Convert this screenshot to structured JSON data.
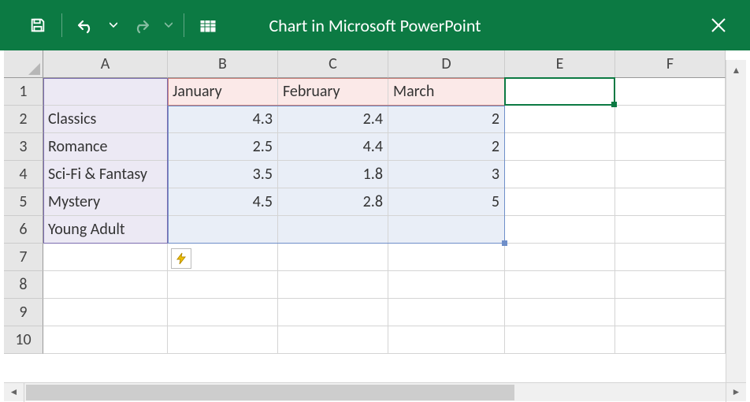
{
  "title": "Chart in Microsoft PowerPoint",
  "columns": {
    "A": 158,
    "B": 140,
    "C": 140,
    "D": 148,
    "E": 140,
    "F": 140
  },
  "row_count": 10,
  "headers": {
    "B1": "January",
    "C1": "February",
    "D1": "March"
  },
  "categories": {
    "A2": "Classics",
    "A3": "Romance",
    "A4": "Sci-Fi & Fantasy",
    "A5": "Mystery",
    "A6": "Young Adult"
  },
  "values": {
    "B2": "4.3",
    "C2": "2.4",
    "D2": "2",
    "B3": "2.5",
    "C3": "4.4",
    "D3": "2",
    "B4": "3.5",
    "C4": "1.8",
    "D4": "3",
    "B5": "4.5",
    "C5": "2.8",
    "D5": "5"
  },
  "active_cell": "E1",
  "chart_data": {
    "type": "bar",
    "categories": [
      "Classics",
      "Romance",
      "Sci-Fi & Fantasy",
      "Mystery",
      "Young Adult"
    ],
    "series": [
      {
        "name": "January",
        "values": [
          4.3,
          2.5,
          3.5,
          4.5,
          null
        ]
      },
      {
        "name": "February",
        "values": [
          2.4,
          4.4,
          1.8,
          2.8,
          null
        ]
      },
      {
        "name": "March",
        "values": [
          2,
          2,
          3,
          5,
          null
        ]
      }
    ],
    "title": "",
    "xlabel": "",
    "ylabel": ""
  }
}
